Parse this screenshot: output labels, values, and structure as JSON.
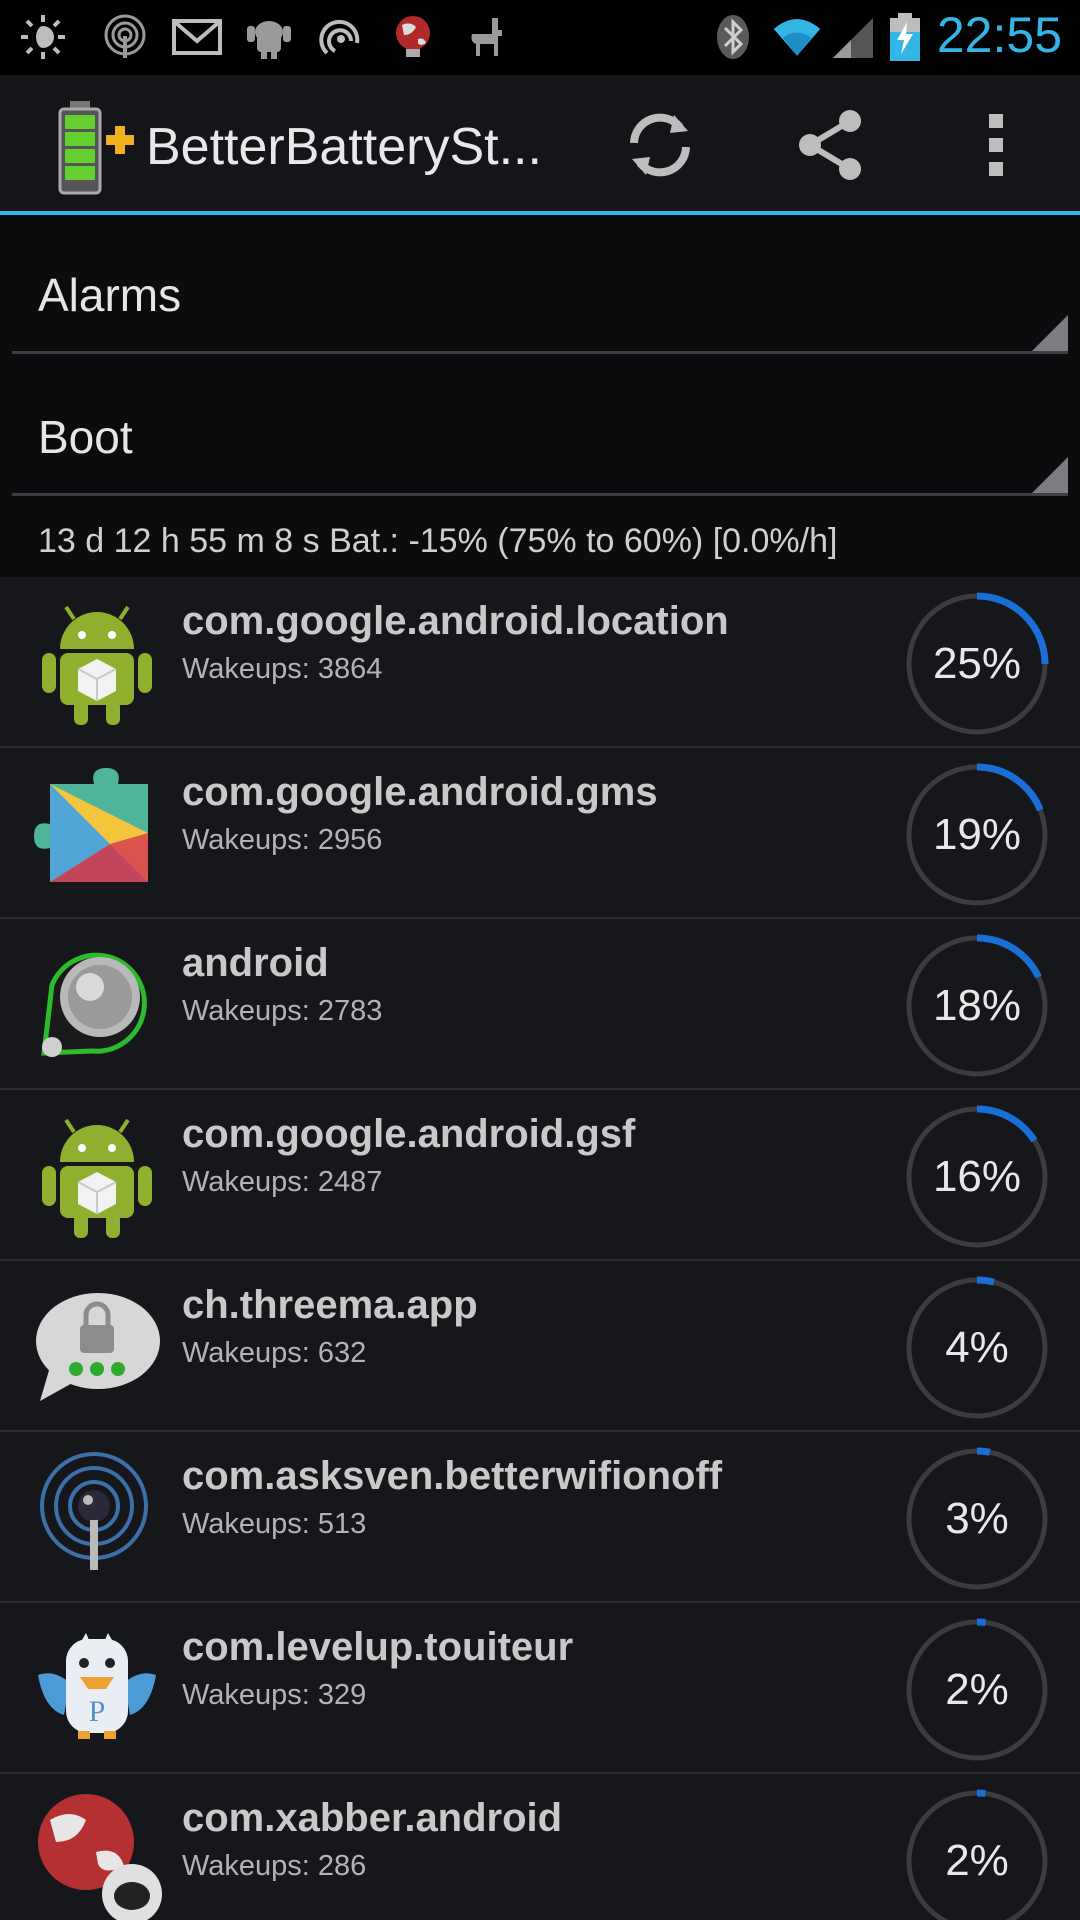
{
  "status_bar": {
    "icons": [
      "brightness-icon",
      "wifi-tether-icon",
      "gmail-icon",
      "android-bug-icon",
      "sync-icon",
      "globe-bulb-icon",
      "llama-icon",
      "bluetooth-icon",
      "wifi-icon",
      "signal-icon",
      "battery-charging-icon"
    ],
    "time": "22:55",
    "accent": "#33b5e5"
  },
  "action_bar": {
    "title": "BetterBatterySt...",
    "logo_icon": "battery-plus-icon",
    "refresh_icon": "refresh-icon",
    "share_icon": "share-icon",
    "overflow_icon": "overflow-menu-icon"
  },
  "spinners": {
    "stat_type": "Alarms",
    "reference": "Boot"
  },
  "summary": "13 d 12 h 55 m 8 s  Bat.: -15% (75% to 60%) [0.0%/h]",
  "colors": {
    "gauge_fill": "#1a6fd6",
    "gauge_track": "#3a3c40"
  },
  "rows": [
    {
      "name": "com.google.android.location",
      "wakeups": "Wakeups: 3864",
      "percent_label": "25%",
      "percent": 25,
      "icon": "android-robot-icon"
    },
    {
      "name": "com.google.android.gms",
      "wakeups": "Wakeups: 2956",
      "percent_label": "19%",
      "percent": 19,
      "icon": "play-services-icon"
    },
    {
      "name": "android",
      "wakeups": "Wakeups: 2783",
      "percent_label": "18%",
      "percent": 18,
      "icon": "android-knob-icon"
    },
    {
      "name": "com.google.android.gsf",
      "wakeups": "Wakeups: 2487",
      "percent_label": "16%",
      "percent": 16,
      "icon": "android-robot-icon"
    },
    {
      "name": "ch.threema.app",
      "wakeups": "Wakeups: 632",
      "percent_label": "4%",
      "percent": 4,
      "icon": "threema-icon"
    },
    {
      "name": "com.asksven.betterwifionoff",
      "wakeups": "Wakeups: 513",
      "percent_label": "3%",
      "percent": 3,
      "icon": "wifi-pin-icon"
    },
    {
      "name": "com.levelup.touiteur",
      "wakeups": "Wakeups: 329",
      "percent_label": "2%",
      "percent": 2,
      "icon": "plume-bird-icon"
    },
    {
      "name": "com.xabber.android",
      "wakeups": "Wakeups: 286",
      "percent_label": "2%",
      "percent": 2,
      "icon": "xabber-globe-icon"
    }
  ]
}
